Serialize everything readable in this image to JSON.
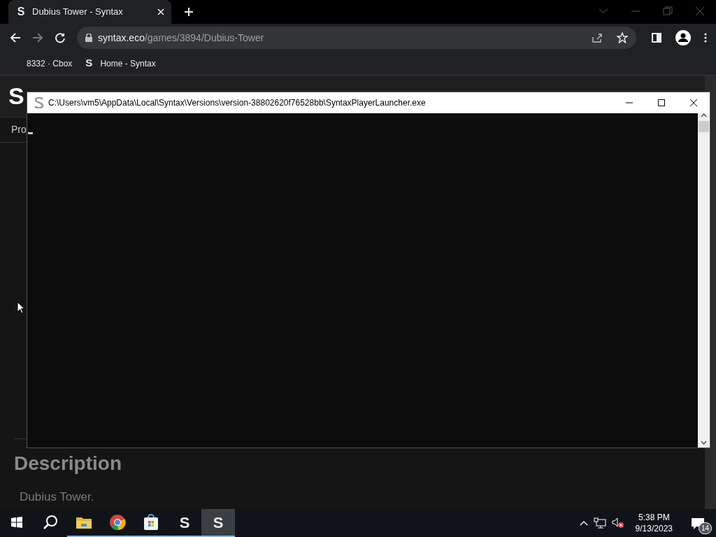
{
  "browser": {
    "tabs": [
      {
        "favicon": "S",
        "title": "Dubius Tower - Syntax",
        "selected": true
      }
    ],
    "address": {
      "host": "syntax.eco",
      "path": "/games/3894/Dubius-Tower"
    },
    "bookmarks": [
      {
        "kind": "plain",
        "label": "8332 · Cbox"
      },
      {
        "kind": "favicon",
        "favicon": "S",
        "label": "Home - Syntax"
      }
    ]
  },
  "page": {
    "logo": "S",
    "nav_item": "Pro",
    "heading": "Description",
    "description": "Dubius Tower."
  },
  "console": {
    "title": "C:\\Users\\vm5\\AppData\\Local\\Syntax\\Versions\\version-38802620f76528bb\\SyntaxPlayerLauncher.exe"
  },
  "taskbar": {
    "apps": [
      {
        "kind": "search",
        "selected": false
      },
      {
        "kind": "folder",
        "selected": false
      },
      {
        "kind": "chrome",
        "selected": false
      },
      {
        "kind": "store",
        "selected": false
      },
      {
        "kind": "letter",
        "letter": "S",
        "selected": false
      },
      {
        "kind": "letter",
        "letter": "S",
        "selected": true
      }
    ],
    "time": "5:38 PM",
    "date": "9/13/2023",
    "notifications": "14"
  }
}
